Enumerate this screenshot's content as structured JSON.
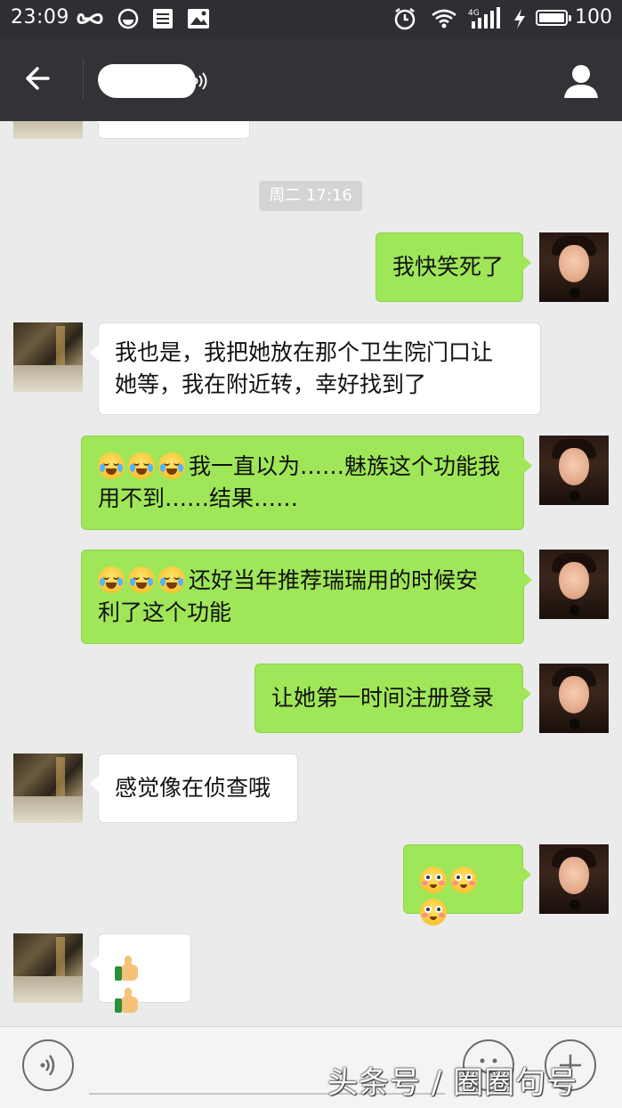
{
  "status_bar": {
    "time": "23:09",
    "battery": "100",
    "battery_level": 1.0,
    "icons": [
      "infinity-icon",
      "sync-icon",
      "list-icon",
      "image-icon",
      "alarm-icon",
      "wifi-icon",
      "4g-signal-icon",
      "charging-icon",
      "battery-icon"
    ]
  },
  "header": {
    "back_icon": "arrow-left-icon",
    "contact_name": "",
    "contact_name_redacted": true,
    "profile_icon": "person-icon",
    "colors": {
      "bar": "#323337",
      "status": "#2e2f33"
    }
  },
  "chat": {
    "timestamp": "周二 17:16",
    "messages": [
      {
        "sender": "me",
        "text": "我快笑死了"
      },
      {
        "sender": "friend",
        "lines": [
          "我也是，我把她放在那个卫生院门口让",
          "她等，我在附近转，幸好找到了"
        ]
      },
      {
        "sender": "me",
        "emoji": [
          "laugh-cry-emoji",
          "laugh-cry-emoji",
          "laugh-cry-emoji"
        ],
        "lines": [
          "我一直以为……魅族这个功能我",
          "用不到……结果……"
        ]
      },
      {
        "sender": "me",
        "emoji": [
          "laugh-cry-emoji",
          "laugh-cry-emoji",
          "laugh-cry-emoji"
        ],
        "lines": [
          "还好当年推荐瑞瑞用的时候安",
          "利了这个功能"
        ]
      },
      {
        "sender": "me",
        "text": "让她第一时间注册登录"
      },
      {
        "sender": "friend",
        "text": "感觉像在侦查哦"
      },
      {
        "sender": "me",
        "emoji": [
          "blush-emoji",
          "blush-emoji",
          "blush-emoji"
        ],
        "text": ""
      },
      {
        "sender": "friend",
        "emoji": [
          "thumbs-up-emoji",
          "thumbs-up-emoji"
        ],
        "text": ""
      }
    ],
    "colors": {
      "me_bubble": "#9fe658",
      "friend_bubble": "#ffffff",
      "background": "#ebebeb"
    }
  },
  "input_bar": {
    "voice_icon": "voice-icon",
    "emoji_icon": "smile-icon",
    "plus_icon": "plus-icon",
    "placeholder": ""
  },
  "watermark": {
    "text": "头条号 / 圈圈句号"
  }
}
